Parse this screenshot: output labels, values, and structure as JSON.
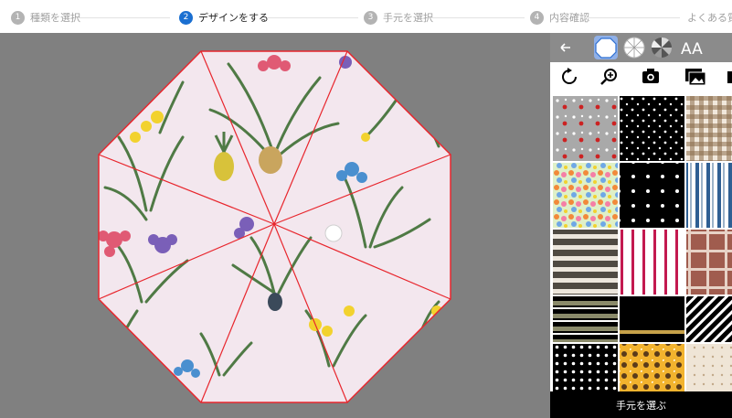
{
  "steps": [
    {
      "num": "1",
      "label": "種類を選択",
      "active": false
    },
    {
      "num": "2",
      "label": "デザインをする",
      "active": true
    },
    {
      "num": "3",
      "label": "手元を選択",
      "active": false
    },
    {
      "num": "4",
      "label": "内容確認",
      "active": false
    },
    {
      "num": "",
      "label": "よくある質",
      "active": false
    }
  ],
  "panel": {
    "top_icons": [
      "back-arrow-icon",
      "octagon-shape-icon",
      "white-segments-icon",
      "dark-segments-icon",
      "text-style-icon"
    ],
    "text_icon_label": "AA",
    "tools": [
      "rotate-icon",
      "zoom-in-icon",
      "camera-icon",
      "gallery-icon",
      "extra-tool-icon"
    ],
    "patterns": [
      "ladybug-gray",
      "white-dots-black",
      "brown-gingham",
      "flower-multicolor",
      "white-dots-black-small",
      "blue-stripes",
      "brown-stripes",
      "pink-white-stripes",
      "brown-plaid",
      "olive-black-stripes",
      "black-gold-stripes",
      "diagonal-stripes",
      "white-polka-dots-black",
      "sunflower",
      "beige-dots"
    ],
    "choose_button": "手元を選ぶ"
  },
  "colors": {
    "accent": "#1a6fd1",
    "canvas_bg": "#808080",
    "umbrella_fill": "#f3e7ee",
    "rib_line": "#e8262d"
  }
}
